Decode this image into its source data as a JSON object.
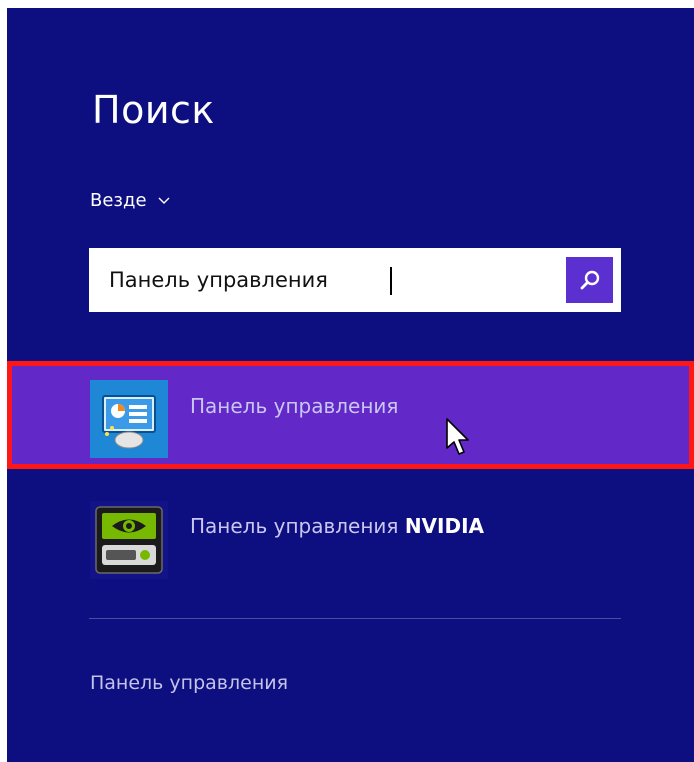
{
  "search_pane": {
    "title": "Поиск",
    "scope": {
      "label": "Везде",
      "chevron_icon": "chevron-down-icon"
    },
    "search": {
      "value": "Панель управления",
      "placeholder": "",
      "button_icon": "search-icon"
    },
    "results": [
      {
        "label": "Панель управления",
        "icon": "control-panel-icon",
        "selected": true
      },
      {
        "label": "Панель управления ",
        "label_bold": "NVIDIA",
        "icon": "nvidia-icon",
        "selected": false
      }
    ],
    "footer_link": "Панель управления"
  },
  "colors": {
    "background": "#0d0e80",
    "highlight": "#6229c8",
    "highlight_border": "#ff1616",
    "search_button": "#5b2fd0"
  }
}
